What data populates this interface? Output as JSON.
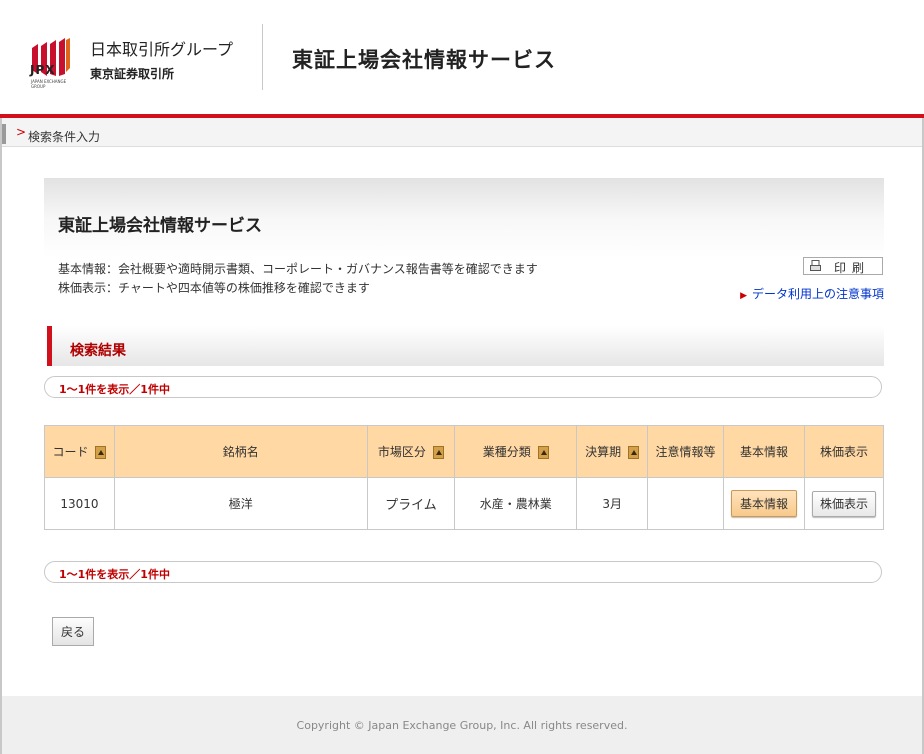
{
  "header": {
    "logo_text": "JPX",
    "logo_subtext": "JAPAN EXCHANGE GROUP",
    "brand_line1": "日本取引所グループ",
    "brand_line2": "東京証券取引所",
    "site_title": "東証上場会社情報サービス",
    "accent_color": "#d0101a"
  },
  "breadcrumb": {
    "arrow": ">",
    "label": "検索条件入力"
  },
  "info": {
    "title": "東証上場会社情報サービス",
    "line1": "基本情報：会社概要や適時開示書類、コーポレート・ガバナンス報告書等を確認できます",
    "line2": "株価表示：チャートや四本値等の株価推移を確認できます",
    "print_label": "印刷",
    "notice_link": "データ利用上の注意事項"
  },
  "results": {
    "section_title": "検索結果",
    "count_text": "1～1件を表示／1件中",
    "columns": [
      "コード",
      "銘柄名",
      "市場区分",
      "業種分類",
      "決算期",
      "注意情報等",
      "基本情報",
      "株価表示"
    ],
    "rows": [
      {
        "code": "13010",
        "name": "極洋",
        "market": "プライム",
        "industry": "水産・農林業",
        "fiscal": "3月",
        "caution": "",
        "basic_button": "基本情報",
        "stock_button": "株価表示"
      }
    ]
  },
  "back_button": "戻る",
  "footer": {
    "copyright": "Copyright © Japan Exchange Group, Inc. All rights reserved."
  }
}
